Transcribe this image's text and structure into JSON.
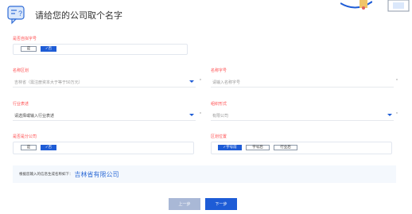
{
  "title": "请给您的公司取个名字",
  "q1": {
    "label": "是否自拟字号",
    "opt_no": "是",
    "opt_yes": "✓否"
  },
  "region": {
    "label": "名称区划",
    "value": "吉林省（需注册资本大于等于50万元）",
    "required": "*"
  },
  "brand": {
    "label": "名称字号",
    "placeholder": "请输入名称字号",
    "required": "*"
  },
  "industry": {
    "label": "行业表述",
    "placeholder": "请选择或输入行业表述",
    "required": "*"
  },
  "org": {
    "label": "组织形式",
    "value": "有限公司",
    "required": "*"
  },
  "branch": {
    "label": "是否是分公司",
    "opt_no": "是",
    "opt_yes": "✓否"
  },
  "position": {
    "label": "区划位置",
    "opt1": "✓字号前",
    "opt2": "字号后",
    "opt3": "行业后"
  },
  "result": {
    "prefix": "根据您输入的信息生成名称如下：",
    "name": "吉林省有限公司"
  },
  "buttons": {
    "prev": "上一步",
    "next": "下一步"
  },
  "colors": {
    "primary": "#1e5cd6",
    "label": "#ff4d4f",
    "result_bg": "#f4f8fd"
  }
}
